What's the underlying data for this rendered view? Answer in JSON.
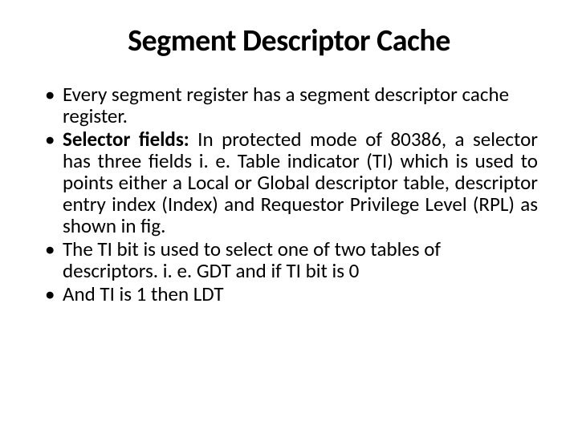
{
  "slide": {
    "title": "Segment Descriptor Cache",
    "bullets": [
      {
        "text": "Every segment register has a segment descriptor cache register."
      },
      {
        "lead": "Selector fields:",
        "rest": " In protected mode of 80386, a selector has three fields i. e. Table indicator (TI) which is used to points either a Local or Global descriptor table, descriptor entry index (Index) and Requestor Privilege Level (RPL) as shown in fig."
      },
      {
        "text": "The TI bit is used to select one of two tables of descriptors. i. e. GDT and if TI bit is 0"
      },
      {
        "text": "And TI is 1 then LDT"
      }
    ]
  }
}
